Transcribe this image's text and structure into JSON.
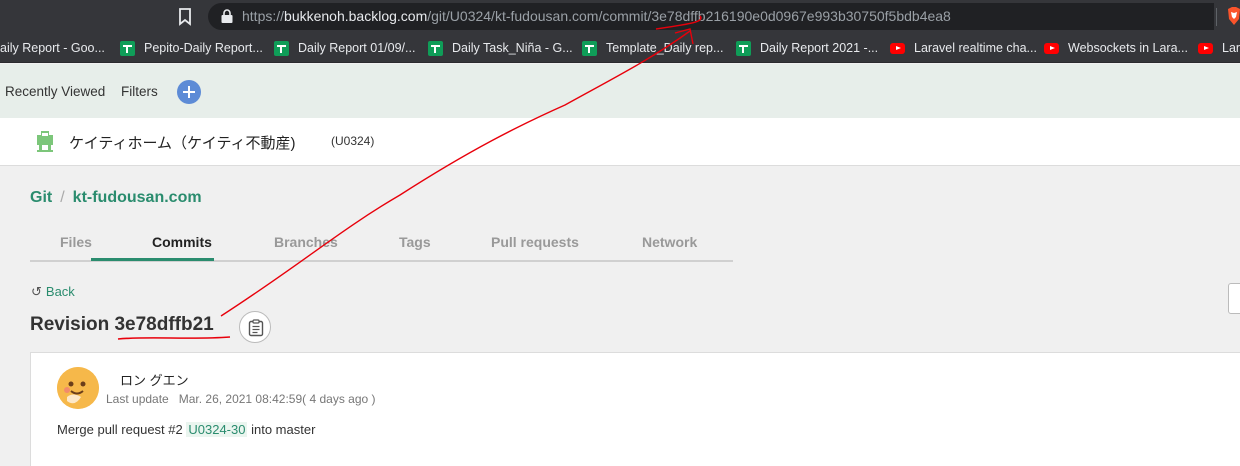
{
  "browser": {
    "url_prefix": "https://",
    "url_host": "bukkenoh.backlog.com",
    "url_path": "/git/U0324/kt-fudousan.com/commit/3e78dffb216190e0d0967e993b30750f5bdb4ea8",
    "bookmarks": [
      {
        "label": "aily Report - Goo...",
        "icon": "sheets-icon"
      },
      {
        "label": "Pepito-Daily Report...",
        "icon": "sheets-icon"
      },
      {
        "label": "Daily Report 01/09/...",
        "icon": "sheets-icon"
      },
      {
        "label": "Daily Task_Niña - G...",
        "icon": "sheets-icon"
      },
      {
        "label": "Template_Daily rep...",
        "icon": "sheets-icon"
      },
      {
        "label": "Daily Report 2021 -...",
        "icon": "sheets-icon"
      },
      {
        "label": "Laravel realtime cha...",
        "icon": "youtube-icon"
      },
      {
        "label": "Websockets in Lara...",
        "icon": "youtube-icon"
      },
      {
        "label": "Lara",
        "icon": "youtube-icon"
      }
    ]
  },
  "topnav": {
    "recently_viewed": "Recently Viewed",
    "filters": "Filters"
  },
  "project": {
    "name": "ケイティホーム（ケイティ不動産)",
    "key": "(U0324)"
  },
  "breadcrumb": {
    "root": "Git",
    "separator": "/",
    "repo": "kt-fudousan.com"
  },
  "tabs": [
    {
      "label": "Files",
      "active": false
    },
    {
      "label": "Commits",
      "active": true
    },
    {
      "label": "Branches",
      "active": false
    },
    {
      "label": "Tags",
      "active": false
    },
    {
      "label": "Pull requests",
      "active": false
    },
    {
      "label": "Network",
      "active": false
    }
  ],
  "back_label": "Back",
  "revision": {
    "label": "Revision",
    "hash": "3e78dffb21"
  },
  "commit": {
    "author": "ロン グエン",
    "last_update_label": "Last update",
    "date": "Mar. 26, 2021 08:42:59( 4 days ago )",
    "message_prefix": "Merge pull request #2",
    "message_ref": "U0324-30",
    "message_suffix": "into master"
  },
  "colors": {
    "accent": "#2a8c6e",
    "annotation": "#e8000b"
  }
}
